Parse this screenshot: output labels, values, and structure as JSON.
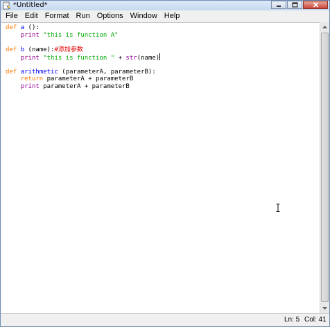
{
  "window": {
    "title": "*Untitled*",
    "icon": "python-idle-icon"
  },
  "menu": {
    "items": [
      "File",
      "Edit",
      "Format",
      "Run",
      "Options",
      "Window",
      "Help"
    ]
  },
  "editor": {
    "code_lines": [
      [
        {
          "t": "def ",
          "c": "kw"
        },
        {
          "t": "a",
          "c": "fn"
        },
        {
          "t": " ():",
          "c": ""
        }
      ],
      [
        {
          "t": "    ",
          "c": ""
        },
        {
          "t": "print",
          "c": "bi"
        },
        {
          "t": " ",
          "c": ""
        },
        {
          "t": "\"this is function A\"",
          "c": "str"
        }
      ],
      [],
      [
        {
          "t": "def ",
          "c": "kw"
        },
        {
          "t": "b",
          "c": "fn"
        },
        {
          "t": " (name):",
          "c": ""
        },
        {
          "t": "#添加参数",
          "c": "cm"
        }
      ],
      [
        {
          "t": "    ",
          "c": ""
        },
        {
          "t": "print",
          "c": "bi"
        },
        {
          "t": " ",
          "c": ""
        },
        {
          "t": "\"this is function \"",
          "c": "str"
        },
        {
          "t": " + ",
          "c": ""
        },
        {
          "t": "str",
          "c": "bi"
        },
        {
          "t": "(name)",
          "c": ""
        }
      ],
      [],
      [
        {
          "t": "def ",
          "c": "kw"
        },
        {
          "t": "arithmetic",
          "c": "fn"
        },
        {
          "t": " (parameterA, parameterB):",
          "c": ""
        }
      ],
      [
        {
          "t": "    ",
          "c": ""
        },
        {
          "t": "return",
          "c": "kw"
        },
        {
          "t": " parameterA + parameterB",
          "c": ""
        }
      ],
      [
        {
          "t": "    ",
          "c": ""
        },
        {
          "t": "print",
          "c": "bi"
        },
        {
          "t": " parameterA + parameterB",
          "c": ""
        }
      ]
    ],
    "cursor_line_index": 4
  },
  "status": {
    "ln": "Ln: 5",
    "col": "Col: 41"
  },
  "colors": {
    "keyword": "#ff7700",
    "builtin": "#900090",
    "definition": "#0000ff",
    "string": "#00aa00",
    "comment": "#dd0000"
  }
}
